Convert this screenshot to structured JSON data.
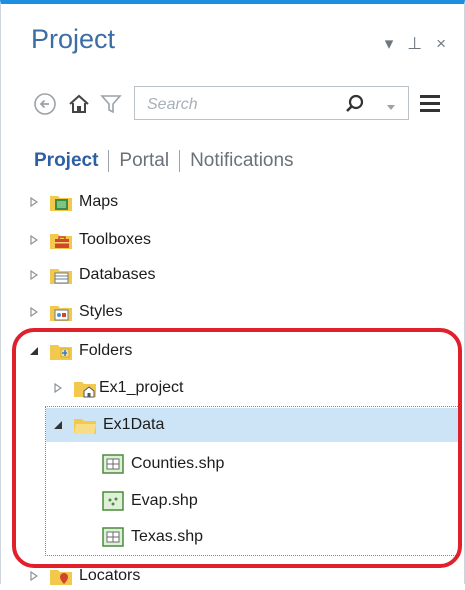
{
  "panel": {
    "title": "Project",
    "controls": {
      "dropdown": "▾",
      "pin": "⊥",
      "close": "×"
    }
  },
  "toolbar": {
    "search_placeholder": "Search",
    "icons": [
      "back-arrow-icon",
      "home-icon",
      "filter-icon",
      "search-icon",
      "dropdown-arrow-icon",
      "menu-icon"
    ]
  },
  "tabs": [
    {
      "label": "Project",
      "active": true
    },
    {
      "label": "Portal",
      "active": false
    },
    {
      "label": "Notifications",
      "active": false
    }
  ],
  "tree": {
    "maps": "Maps",
    "toolboxes": "Toolboxes",
    "databases": "Databases",
    "styles": "Styles",
    "folders": "Folders",
    "ex1_project": "Ex1_project",
    "ex1data": "Ex1Data",
    "counties": "Counties.shp",
    "evap": "Evap.shp",
    "texas": "Texas.shp",
    "locators": "Locators"
  },
  "colors": {
    "accent_top_border": "#1d8fe0",
    "title": "#3a6ea5",
    "active_tab": "#2c5fa4",
    "selection": "#cde4f6",
    "highlight_outline": "#e0202a"
  }
}
